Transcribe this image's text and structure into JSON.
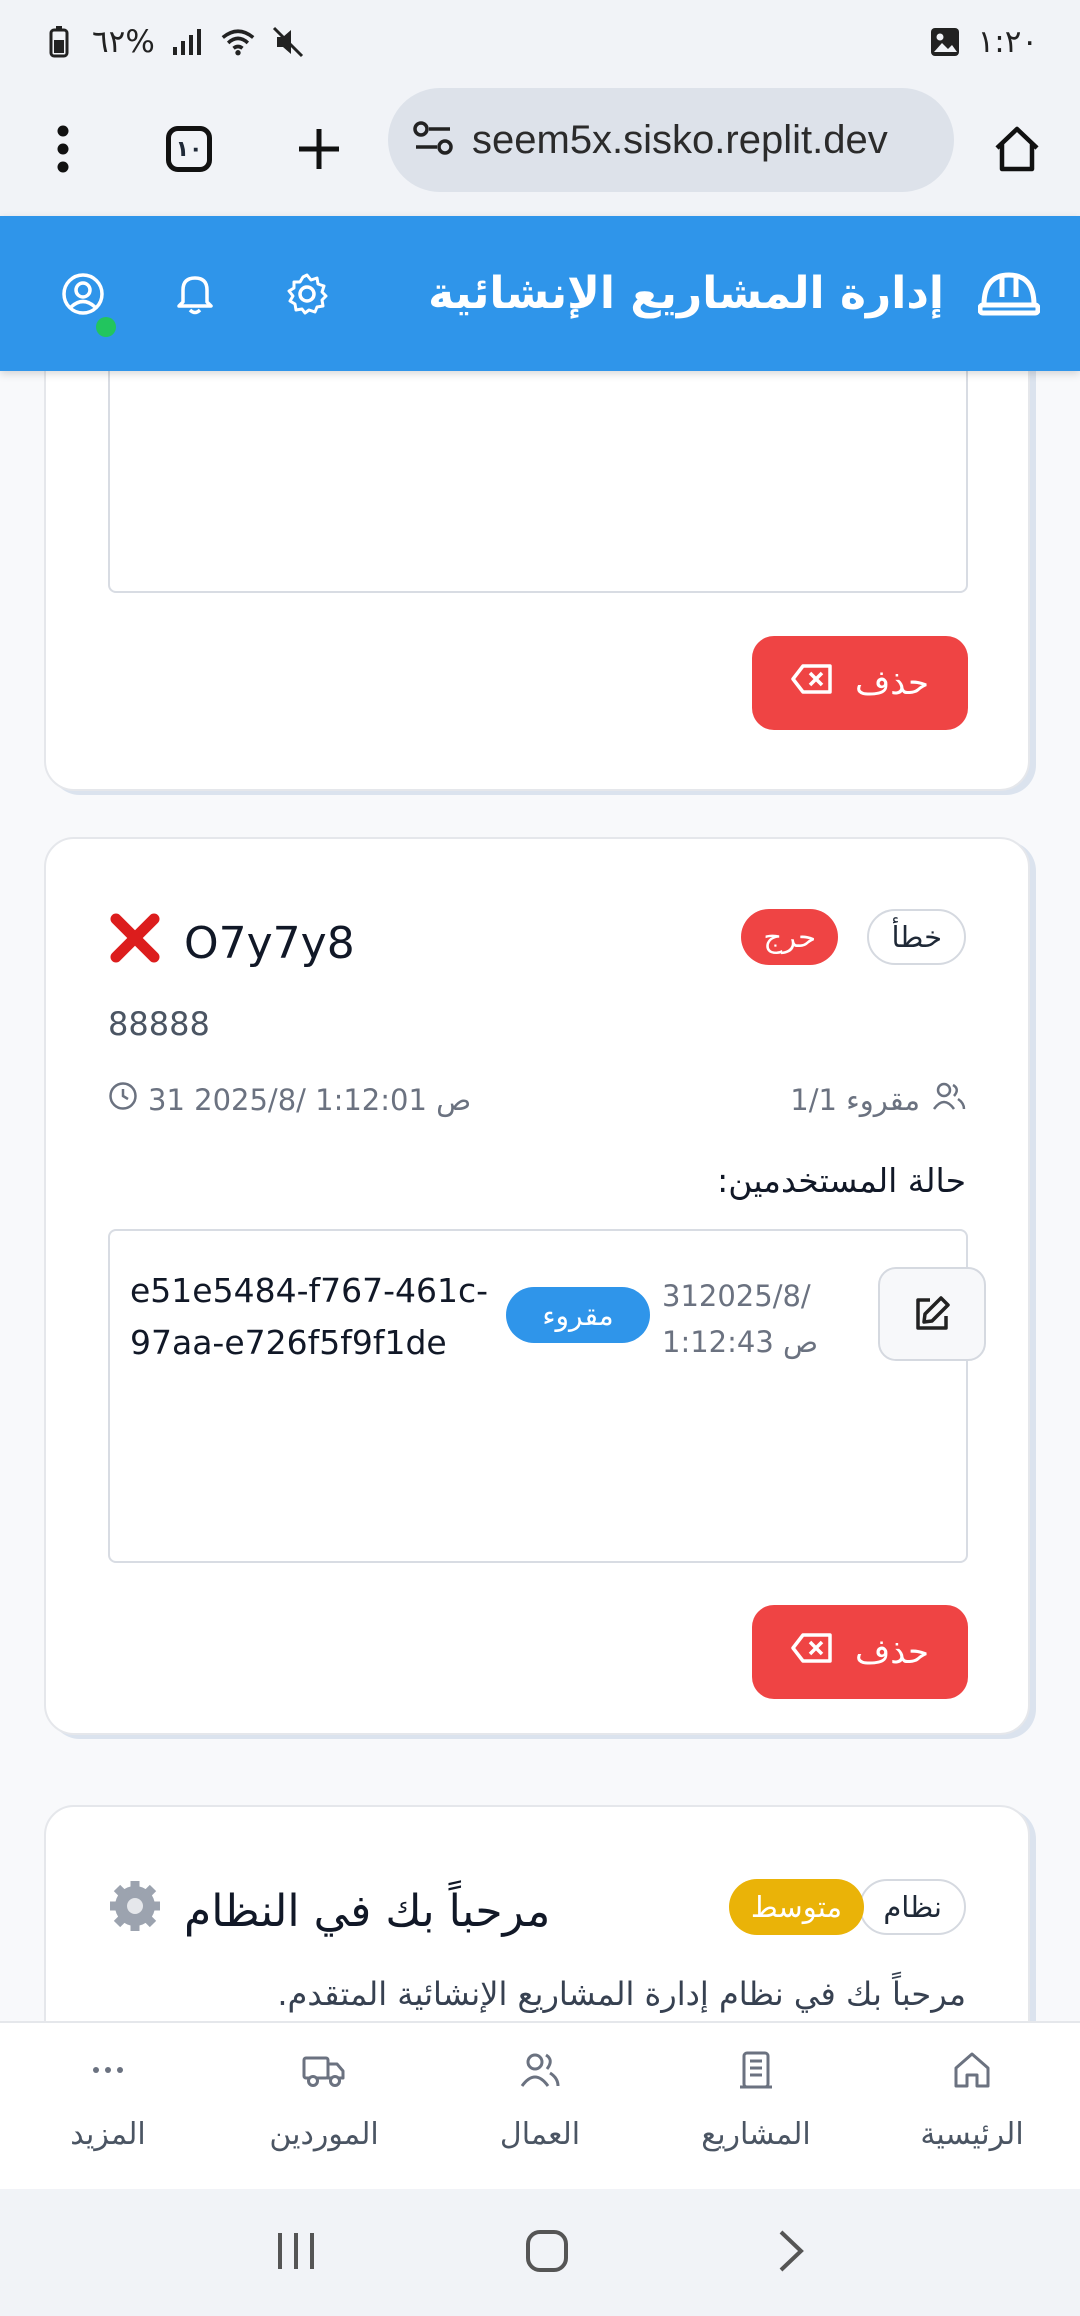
{
  "status_bar": {
    "time": "١:٢٠",
    "battery": "٦٢%"
  },
  "browser": {
    "tab_count": "١٠",
    "url": "seem5x.sisko.replit.dev"
  },
  "header": {
    "title": "إدارة المشاريع الإنشائية"
  },
  "card_top": {
    "delete_label": "حذف"
  },
  "card_error": {
    "title": "O7y7y8",
    "type_badge": "خطأ",
    "priority_badge": "حرج",
    "message": "88888",
    "timestamp": "31 2025/8/ 1:12:01 ص",
    "read_count": "مقروء 1/1",
    "users_status_label": "حالة المستخدمين:",
    "user_row": {
      "user_id": "e51e5484-f767-461c-97aa-e726f5f9f1de",
      "status": "مقروء",
      "date_line1": "312025/8/",
      "date_line2": "1:12:43 ص"
    },
    "delete_label": "حذف"
  },
  "card_welcome": {
    "title": "مرحباً بك في النظام",
    "type_badge": "نظام",
    "priority_badge": "متوسط",
    "message": "مرحباً بك في نظام إدارة المشاريع الإنشائية المتقدم."
  },
  "bottom_nav": {
    "items": [
      {
        "label": "الرئيسية",
        "icon": "home-icon"
      },
      {
        "label": "المشاريع",
        "icon": "building-icon"
      },
      {
        "label": "العمال",
        "icon": "users-icon"
      },
      {
        "label": "الموردين",
        "icon": "truck-icon"
      },
      {
        "label": "المزيد",
        "icon": "more-icon"
      }
    ]
  },
  "colors": {
    "header": "#2f95ea",
    "danger": "#ef4444",
    "warning": "#eab308",
    "online": "#22c55e"
  }
}
